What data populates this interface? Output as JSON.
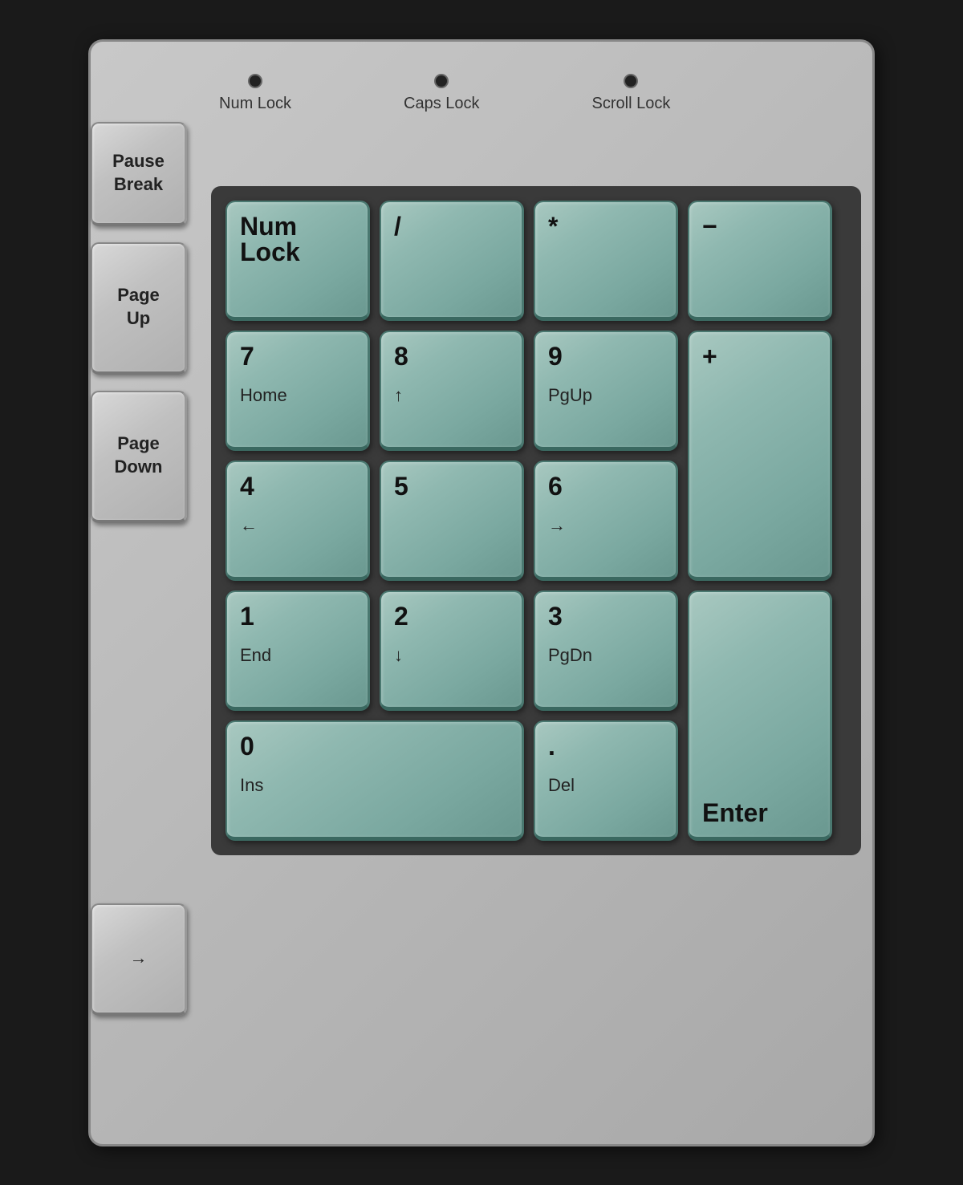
{
  "keyboard": {
    "background_color": "#b8b8b8",
    "leds": [
      {
        "id": "num-lock-led",
        "label": "Num Lock"
      },
      {
        "id": "caps-lock-led",
        "label": "Caps Lock"
      },
      {
        "id": "scroll-lock-led",
        "label": "Scroll Lock"
      }
    ],
    "side_keys": [
      {
        "id": "pause-break",
        "label": "Pause\nBreak"
      },
      {
        "id": "page-up",
        "label": "Page\nUp"
      },
      {
        "id": "page-down",
        "label": "Page\nDown"
      }
    ],
    "arrow_key": {
      "id": "right-arrow",
      "label": "→"
    },
    "numpad": {
      "keys": [
        {
          "id": "num-lock-key",
          "primary": "Num",
          "secondary_line2": "Lock",
          "is_two_line_primary": true
        },
        {
          "id": "divide",
          "primary": "/",
          "secondary": ""
        },
        {
          "id": "multiply",
          "primary": "*",
          "secondary": ""
        },
        {
          "id": "minus",
          "primary": "−",
          "secondary": ""
        },
        {
          "id": "num7",
          "primary": "7",
          "secondary": "Home"
        },
        {
          "id": "num8",
          "primary": "8",
          "secondary": "↑"
        },
        {
          "id": "num9",
          "primary": "9",
          "secondary": "PgUp"
        },
        {
          "id": "plus",
          "primary": "+",
          "secondary": "",
          "span": "tall"
        },
        {
          "id": "num4",
          "primary": "4",
          "secondary": "←"
        },
        {
          "id": "num5",
          "primary": "5",
          "secondary": ""
        },
        {
          "id": "num6",
          "primary": "6",
          "secondary": "→"
        },
        {
          "id": "num1",
          "primary": "1",
          "secondary": "End"
        },
        {
          "id": "num2",
          "primary": "2",
          "secondary": "↓"
        },
        {
          "id": "num3",
          "primary": "3",
          "secondary": "PgDn"
        },
        {
          "id": "enter",
          "primary": "Enter",
          "secondary": "",
          "span": "tall"
        },
        {
          "id": "num0",
          "primary": "0",
          "secondary": "Ins",
          "span": "wide"
        },
        {
          "id": "decimal",
          "primary": ".",
          "secondary": "Del"
        }
      ]
    }
  }
}
